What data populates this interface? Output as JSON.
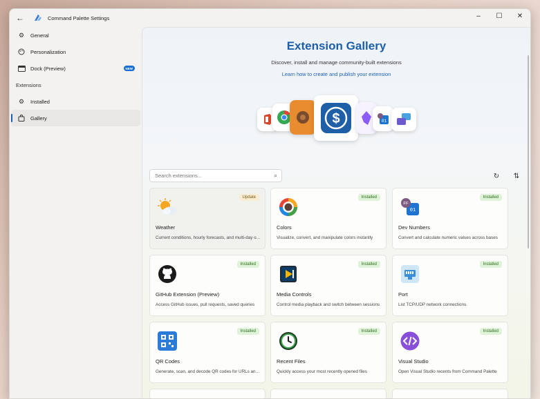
{
  "window": {
    "title": "Command Palette Settings",
    "controls": {
      "minimize": "–",
      "maximize": "☐",
      "close": "✕"
    }
  },
  "sidebar": {
    "items": [
      {
        "label": "General",
        "icon": "gear-icon"
      },
      {
        "label": "Personalization",
        "icon": "palette-icon"
      },
      {
        "label": "Dock (Preview)",
        "icon": "dock-icon",
        "badge": "NEW"
      }
    ],
    "section_label": "Extensions",
    "ext_items": [
      {
        "label": "Installed",
        "icon": "gear-icon"
      },
      {
        "label": "Gallery",
        "icon": "bag-icon",
        "active": true
      }
    ]
  },
  "hero": {
    "title": "Extension Gallery",
    "subtitle": "Discover, install and manage community-built extensions",
    "link": "Learn how to create and publish your extension"
  },
  "search": {
    "placeholder": "Search extensions..."
  },
  "cards": [
    {
      "name": "Weather",
      "desc": "Current conditions, hourly forecasts, and multi-day outlooks",
      "status": "Update",
      "icon": "weather-icon"
    },
    {
      "name": "Colors",
      "desc": "Visualize, convert, and manipulate colors instantly",
      "status": "Installed",
      "icon": "color-wheel-icon"
    },
    {
      "name": "Dev Numbers",
      "desc": "Convert and calculate numeric values across bases",
      "status": "Installed",
      "icon": "dev-numbers-icon"
    },
    {
      "name": "GitHub Extension (Preview)",
      "desc": "Access GitHub issues, pull requests, saved queries",
      "status": "Installed",
      "icon": "github-icon"
    },
    {
      "name": "Media Controls",
      "desc": "Control media playback and switch between sessions",
      "status": "Installed",
      "icon": "media-controls-icon"
    },
    {
      "name": "Port",
      "desc": "List TCP/UDP network connections.",
      "status": "Installed",
      "icon": "port-icon"
    },
    {
      "name": "QR Codes",
      "desc": "Generate, scan, and decode QR codes for URLs and text",
      "status": "Installed",
      "icon": "qr-code-icon"
    },
    {
      "name": "Recent Files",
      "desc": "Quickly access your most recently opened files",
      "status": "Installed",
      "icon": "recent-files-icon"
    },
    {
      "name": "Visual Studio",
      "desc": "Open Visual Studio recents from Command Palette",
      "status": "Installed",
      "icon": "visual-studio-icon"
    }
  ]
}
